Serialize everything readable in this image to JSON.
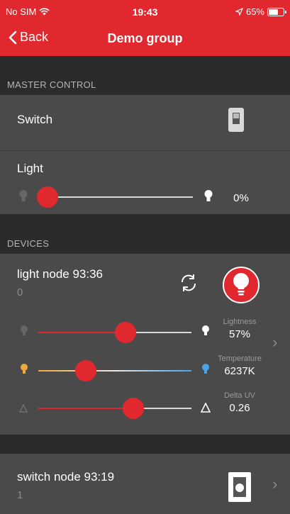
{
  "status": {
    "carrier": "No SIM",
    "time": "19:43",
    "battery": "65%",
    "battery_level": 0.65
  },
  "nav": {
    "back_label": "Back",
    "title": "Demo group"
  },
  "master": {
    "section_label": "MASTER CONTROL",
    "switch_label": "Switch",
    "light_label": "Light",
    "light_value": "0%",
    "light_level": 0.0
  },
  "devices": {
    "section_label": "DEVICES",
    "light_node": {
      "name": "light node 93:36",
      "sub": "0",
      "lightness": {
        "label": "Lightness",
        "value": "57%",
        "level": 0.57
      },
      "temperature": {
        "label": "Temperature",
        "value": "6237K",
        "level": 0.31
      },
      "delta_uv": {
        "label": "Delta UV",
        "value": "0.26",
        "level": 0.62
      }
    },
    "switch_node": {
      "name": "switch node 93:19",
      "sub": "1"
    }
  },
  "colors": {
    "accent": "#e0282e",
    "panel": "#4a4a4a",
    "background": "#2b2b2b"
  }
}
